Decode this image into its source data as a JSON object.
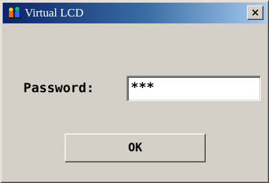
{
  "window": {
    "title": "Virtual LCD",
    "close_label": "×",
    "icon": "app-icon"
  },
  "form": {
    "password_label": "Password:",
    "password_value": "***"
  },
  "buttons": {
    "ok_label": "OK"
  },
  "colors": {
    "title_bar_start": "#0a246a",
    "title_bar_end": "#a6caf0",
    "dialog_background": "#d4d0c8"
  }
}
